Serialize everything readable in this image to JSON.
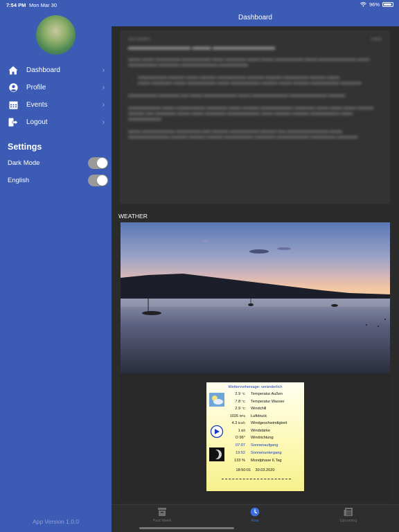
{
  "status_bar": {
    "time": "7:54 PM",
    "date": "Mon Mar 30",
    "battery": "96%"
  },
  "sidebar": {
    "items": [
      {
        "label": "Dashboard",
        "icon": "home-icon"
      },
      {
        "label": "Profile",
        "icon": "user-circle-icon"
      },
      {
        "label": "Events",
        "icon": "calendar-icon"
      },
      {
        "label": "Logout",
        "icon": "logout-icon"
      }
    ],
    "settings_title": "Settings",
    "settings": [
      {
        "label": "Dark Mode",
        "on": true
      },
      {
        "label": "English",
        "on": true
      }
    ],
    "app_version": "App Version 1.0.0"
  },
  "header": {
    "title": "Dashboard"
  },
  "weather": {
    "section_label": "WEATHER",
    "forecast_title": "Wettervorhersage: veränderlich",
    "rows": [
      {
        "value": "2.9",
        "unit": "°C",
        "name": "Temperatur Außen",
        "color": "black"
      },
      {
        "value": "7.8",
        "unit": "°C",
        "name": "Temperatur Wasser",
        "color": "black"
      },
      {
        "value": "2.9",
        "unit": "°C",
        "name": "Windchill",
        "color": "black"
      },
      {
        "value": "1026",
        "unit": "hPa",
        "name": "Luftdruck",
        "color": "black"
      },
      {
        "value": "4.3",
        "unit": "km/h",
        "name": "Windgeschwindigkeit",
        "color": "black"
      },
      {
        "value": "1",
        "unit": "Bft",
        "name": "Windstärke",
        "color": "black"
      },
      {
        "value": "O 96°",
        "unit": "",
        "name": "Windrichtung",
        "color": "black"
      },
      {
        "value": "07:07",
        "unit": "",
        "name": "Sonnenaufgang",
        "color": "blue"
      },
      {
        "value": "19:52",
        "unit": "",
        "name": "Sonnenuntergang",
        "color": "blue"
      },
      {
        "value": "133 %",
        "unit": "",
        "name": "Mondphase 6.Tag",
        "color": "black"
      }
    ],
    "footer_time": "18:50:01",
    "footer_date": "30.03.2020"
  },
  "tabbar": {
    "tabs": [
      {
        "label": "Past Week",
        "icon": "archive-icon",
        "active": false
      },
      {
        "label": "Now",
        "icon": "clock-icon",
        "active": true
      },
      {
        "label": "Upcoming",
        "icon": "newspaper-icon",
        "active": false
      }
    ]
  },
  "colors": {
    "sidebar": "#3b5bb5",
    "accent": "#3d6fe0",
    "background": "#2b2b2b"
  }
}
